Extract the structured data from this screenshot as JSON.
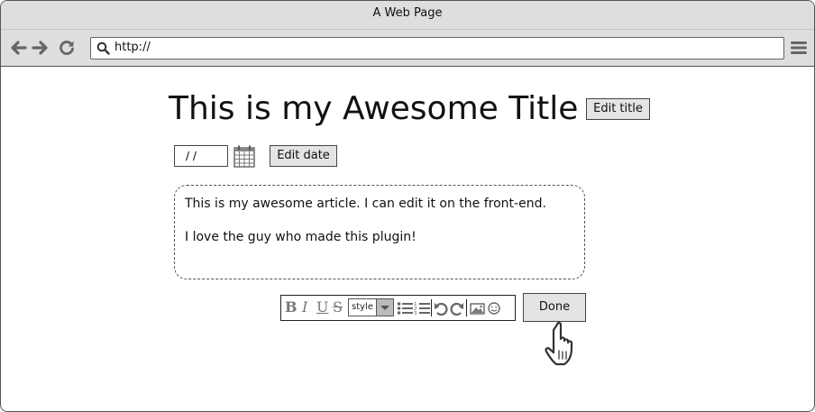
{
  "window": {
    "title": "A Web Page"
  },
  "toolbar": {
    "url": "http://",
    "icons": [
      "back-arrow-icon",
      "forward-arrow-icon",
      "reload-icon",
      "search-icon",
      "hamburger-menu-icon"
    ]
  },
  "page": {
    "title": "This is my Awesome Title",
    "edit_title_label": "Edit title",
    "date_value": "/ /",
    "edit_date_label": "Edit date",
    "article": {
      "paragraphs": [
        "This is my awesome article. I can edit it on the front-end.",
        "I love the guy who made this plugin!"
      ]
    },
    "editor_toolbar": {
      "bold": "B",
      "italic": "I",
      "underline": "U",
      "strike": "S",
      "style_select": "style",
      "icons": [
        "bulleted-list-icon",
        "numbered-list-icon",
        "undo-icon",
        "redo-icon",
        "image-icon",
        "emoji-icon"
      ]
    },
    "done_label": "Done"
  },
  "colors": {
    "chrome_bg": "#dedede",
    "border": "#444444",
    "button_bg": "#e4e4e4",
    "icon_gray": "#777777"
  }
}
